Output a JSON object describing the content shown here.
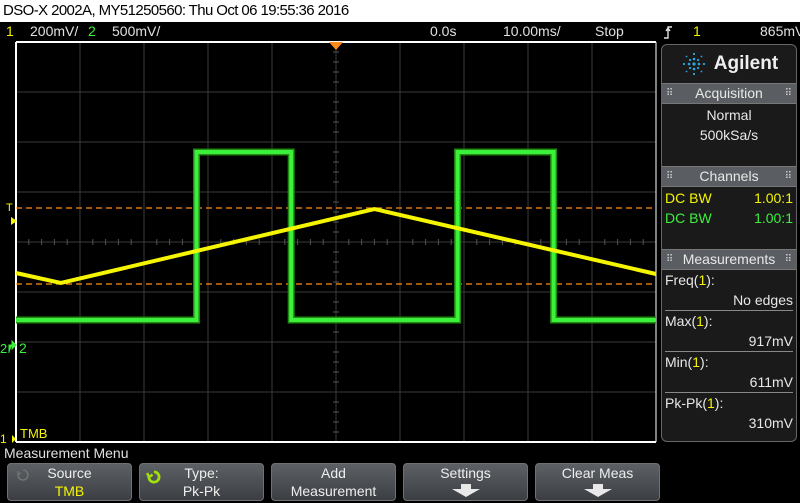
{
  "title_bar": "DSO-X 2002A, MY51250560: Thu Oct 06 19:55:36 2016",
  "status": {
    "ch1_num": "1",
    "ch1_scale": "200mV/",
    "ch2_num": "2",
    "ch2_scale": "500mV/",
    "time_delay": "0.0s",
    "time_scale": "10.00ms/",
    "run_state": "Stop",
    "trigger_edge_icon": "rising-edge-icon",
    "trigger_source": "1",
    "trigger_level": "865mV"
  },
  "graticule": {
    "ch2_marker": "2",
    "ch1_marker": "1",
    "trigger_marker": "T",
    "trace_label": "TMB"
  },
  "waveforms": {
    "ch1_color": "#f5f500",
    "ch2_color": "#3cf03c",
    "cursor_color": "#ff8c1a",
    "ch1_triangle_divisions": [
      [
        0,
        3.38
      ],
      [
        0.7,
        3.18
      ],
      [
        5.6,
        4.66
      ],
      [
        10,
        3.36
      ]
    ],
    "ch2_square_high_div": 5.8,
    "ch2_square_low_div": 2.44,
    "ch2_pulses_div": [
      [
        2.82,
        4.3
      ],
      [
        6.9,
        8.4
      ]
    ],
    "cursor_levels_div": [
      4.68,
      3.16
    ]
  },
  "panel": {
    "brand": "Agilent",
    "acquisition": {
      "header": "Acquisition",
      "mode": "Normal",
      "rate": "500kSa/s"
    },
    "channels": {
      "header": "Channels",
      "rows": [
        {
          "coupling": "DC BW",
          "probe": "1.00:1",
          "color": "#f5f500"
        },
        {
          "coupling": "DC BW",
          "probe": "1.00:1",
          "color": "#3cf03c"
        }
      ]
    },
    "measurements": {
      "header": "Measurements",
      "items": [
        {
          "name": "Freq(",
          "src": "1",
          "close": "):",
          "value": "No edges"
        },
        {
          "name": "Max(",
          "src": "1",
          "close": "):",
          "value": "917mV"
        },
        {
          "name": "Min(",
          "src": "1",
          "close": "):",
          "value": "611mV"
        },
        {
          "name": "Pk-Pk(",
          "src": "1",
          "close": "):",
          "value": "310mV"
        }
      ]
    }
  },
  "menu": {
    "title": "Measurement Menu",
    "softkeys": [
      {
        "line1": "Source",
        "line2": "TMB"
      },
      {
        "line1": "Type:",
        "line2": "Pk-Pk"
      },
      {
        "line1": "Add",
        "line2": "Measurement"
      },
      {
        "line1": "Settings",
        "line2": ""
      },
      {
        "line1": "Clear Meas",
        "line2": ""
      }
    ]
  }
}
